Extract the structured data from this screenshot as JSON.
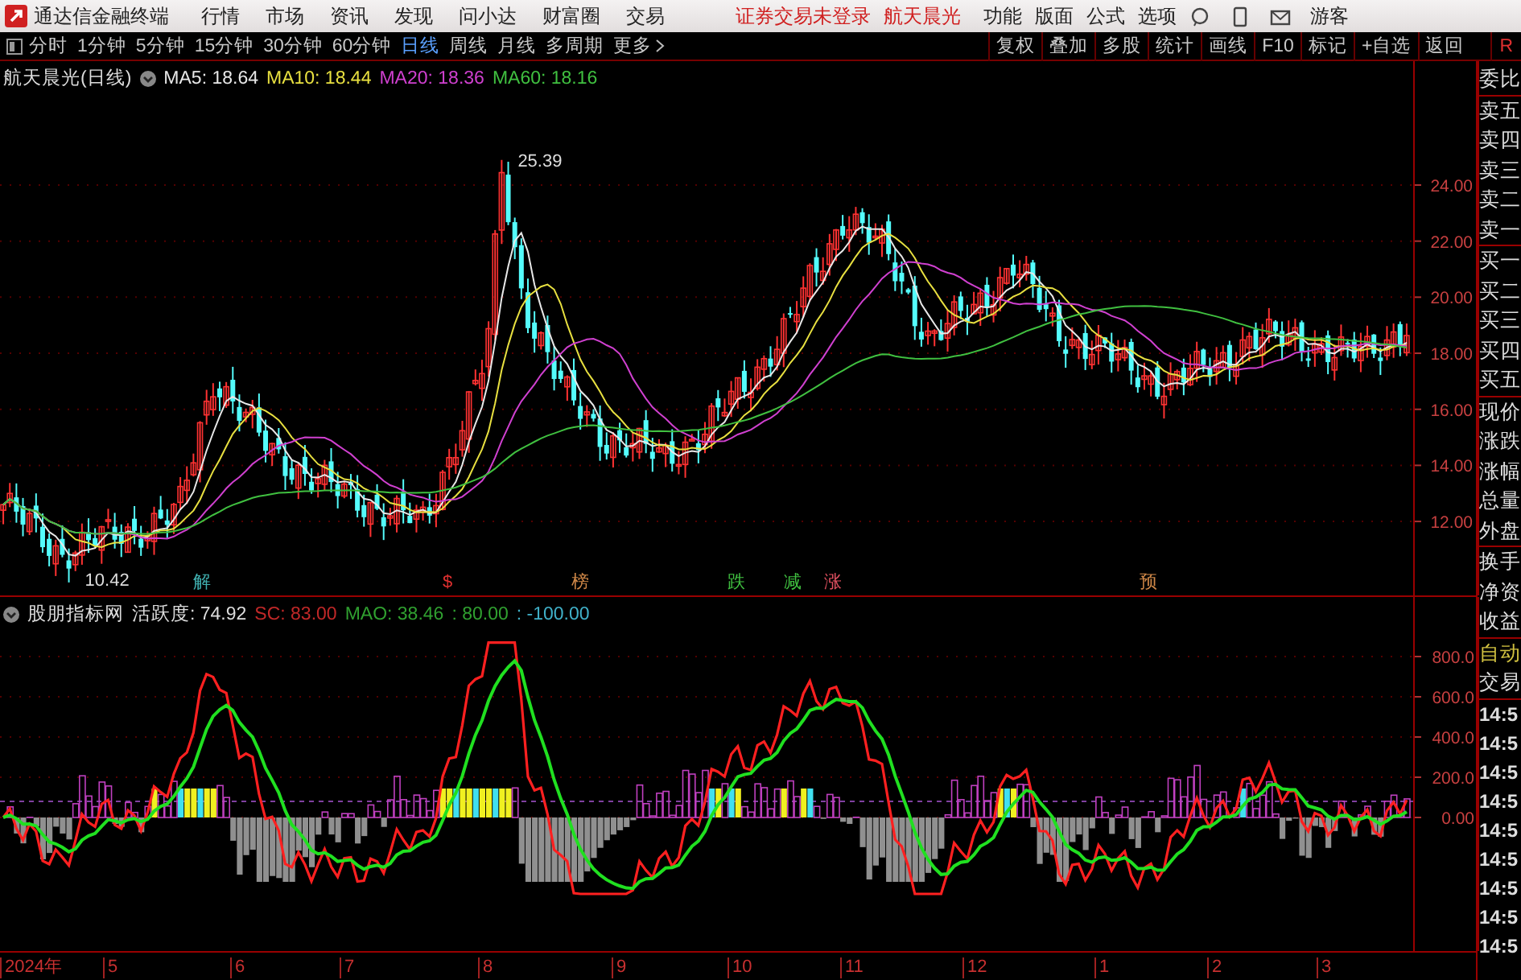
{
  "app": {
    "title": "通达信金融终端"
  },
  "menu": [
    "行情",
    "市场",
    "资讯",
    "发现",
    "问小达",
    "财富圈",
    "交易"
  ],
  "login_status": "证券交易未登录",
  "stock_name": "航天晨光",
  "top_right_menu": [
    "功能",
    "版面",
    "公式",
    "选项"
  ],
  "user": "游客",
  "periods": [
    {
      "label": "分时",
      "selected": false
    },
    {
      "label": "1分钟",
      "selected": false
    },
    {
      "label": "5分钟",
      "selected": false
    },
    {
      "label": "15分钟",
      "selected": false
    },
    {
      "label": "30分钟",
      "selected": false
    },
    {
      "label": "60分钟",
      "selected": false
    },
    {
      "label": "日线",
      "selected": true
    },
    {
      "label": "周线",
      "selected": false
    },
    {
      "label": "月线",
      "selected": false
    },
    {
      "label": "多周期",
      "selected": false
    }
  ],
  "more": "更多",
  "tools": [
    "复权",
    "叠加",
    "多股",
    "统计",
    "画线",
    "F10",
    "标记",
    "+自选",
    "返回"
  ],
  "r_button": "R",
  "main_chart": {
    "title": "航天晨光(日线)",
    "ma": [
      {
        "label": "MA5: 18.64",
        "color": "#e8e8e8"
      },
      {
        "label": "MA10: 18.44",
        "color": "#e8e040"
      },
      {
        "label": "MA20: 18.36",
        "color": "#d040d0"
      },
      {
        "label": "MA60: 18.16",
        "color": "#40c040"
      }
    ],
    "high_label": "25.39",
    "low_label": "10.42",
    "y_labels": [
      "24.00",
      "22.00",
      "20.00",
      "18.00",
      "16.00",
      "14.00",
      "12.00"
    ],
    "signals": [
      {
        "text": "解",
        "color": "#40b0b0"
      },
      {
        "text": "$",
        "color": "#e03030"
      },
      {
        "text": "榜",
        "color": "#d08848"
      },
      {
        "text": "跌",
        "color": "#40c040"
      },
      {
        "text": "减",
        "color": "#40c040"
      },
      {
        "text": "涨",
        "color": "#e05060"
      },
      {
        "text": "预",
        "color": "#d08848"
      }
    ]
  },
  "indicator": {
    "name": "股朋指标网",
    "activity": "活跃度: 74.92",
    "values": [
      {
        "text": "SC: 83.00",
        "color": "#c02828"
      },
      {
        "text": "MAO: 38.46",
        "color": "#30a030"
      },
      {
        "text": ": 80.00",
        "color": "#30a030"
      },
      {
        "text": ": -100.00",
        "color": "#40b0c8"
      }
    ],
    "y_labels": [
      "800.0",
      "600.0",
      "400.0",
      "200.0",
      "0.00"
    ]
  },
  "date_axis": [
    "2024年",
    "5",
    "6",
    "7",
    "8",
    "9",
    "10",
    "11",
    "12",
    "1",
    "2",
    "3"
  ],
  "side_panel": {
    "groups": [
      [
        "委比"
      ],
      [
        "卖五",
        "卖四",
        "卖三",
        "卖二",
        "卖一"
      ],
      [
        "买一",
        "买二",
        "买三",
        "买四",
        "买五"
      ],
      [
        "现价",
        "涨跌",
        "涨幅",
        "总量",
        "外盘"
      ],
      [
        "换手",
        "净资",
        "收益"
      ]
    ],
    "auto": "自动",
    "trade": "交易",
    "times": [
      "14:5",
      "14:5",
      "14:5",
      "14:5",
      "14:5",
      "14:5",
      "14:5",
      "14:5",
      "14:5"
    ]
  }
}
